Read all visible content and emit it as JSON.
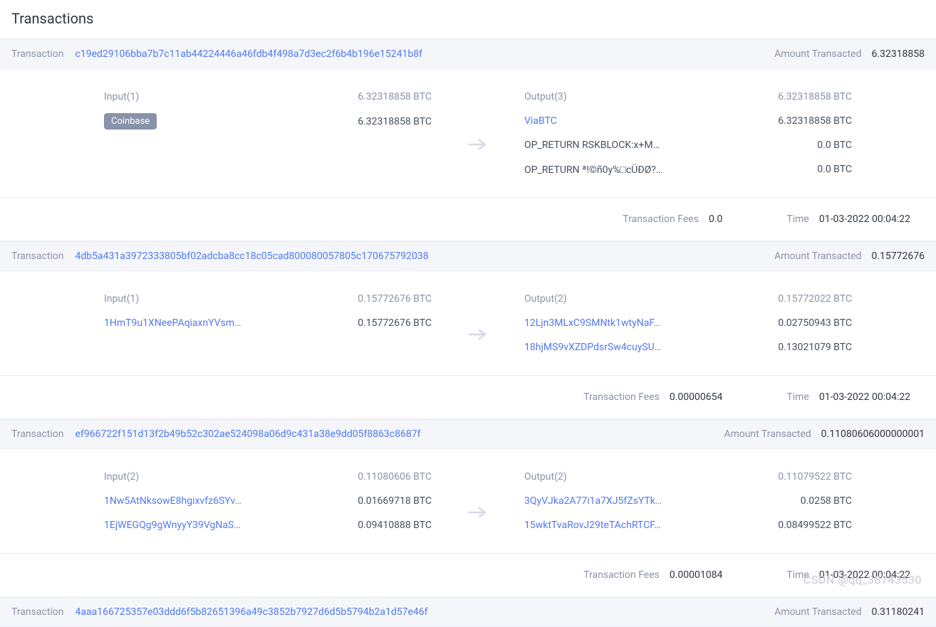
{
  "page_title": "Transactions",
  "labels": {
    "transaction": "Transaction",
    "amount_transacted": "Amount Transacted",
    "transaction_fees": "Transaction Fees",
    "time": "Time"
  },
  "watermark": "CSDN @qq_38743530",
  "transactions": [
    {
      "hash": "c19ed29106bba7b7c11ab44224446a46fdb4f498a7d3ec2f6b4b196e15241b8f",
      "amount_transacted": "6.32318858",
      "input": {
        "label": "Input(1)",
        "total": "6.32318858 BTC",
        "items": [
          {
            "tag": "Coinbase",
            "is_tag": true,
            "value": "6.32318858 BTC"
          }
        ]
      },
      "output": {
        "label": "Output(3)",
        "total": "6.32318858 BTC",
        "items": [
          {
            "text": "ViaBTC",
            "link": true,
            "value": "6.32318858 BTC"
          },
          {
            "text": "OP_RETURN RSKBLOCK:x+M…",
            "link": false,
            "value": "0.0 BTC"
          },
          {
            "text": "OP_RETURN ª!©ñ0y%□cÜÐØ?…",
            "link": false,
            "value": "0.0 BTC"
          }
        ]
      },
      "fees": "0.0",
      "time": "01-03-2022 00:04:22"
    },
    {
      "hash": "4db5a431a3972333805bf02adcba8cc18c05cad800080057805c170675792038",
      "amount_transacted": "0.15772676",
      "input": {
        "label": "Input(1)",
        "total": "0.15772676 BTC",
        "items": [
          {
            "text": "1HmT9u1XNeePAqiaxnYVsm…",
            "link": true,
            "value": "0.15772676 BTC"
          }
        ]
      },
      "output": {
        "label": "Output(2)",
        "total": "0.15772022 BTC",
        "items": [
          {
            "text": "12Ljn3MLxC9SMNtk1wtyNaF…",
            "link": true,
            "value": "0.02750943 BTC"
          },
          {
            "text": "18hjMS9vXZDPdsrSw4cuySU…",
            "link": true,
            "value": "0.13021079 BTC"
          }
        ]
      },
      "fees": "0.00000654",
      "time": "01-03-2022 00:04:22"
    },
    {
      "hash": "ef966722f151d13f2b49b52c302ae524098a06d9c431a38e9dd05f8863c8687f",
      "amount_transacted": "0.11080606000000001",
      "input": {
        "label": "Input(2)",
        "total": "0.11080606 BTC",
        "items": [
          {
            "text": "1Nw5AtNksowE8hgixvfz6SYv…",
            "link": true,
            "value": "0.01669718 BTC"
          },
          {
            "text": "1EjWEGQg9gWnyyY39VgNaS…",
            "link": true,
            "value": "0.09410888 BTC"
          }
        ]
      },
      "output": {
        "label": "Output(2)",
        "total": "0.11079522 BTC",
        "items": [
          {
            "text": "3QyVJka2A77i1a7XJ5fZsYTk…",
            "link": true,
            "value": "0.0258 BTC"
          },
          {
            "text": "15wktTvaRovJ29teTAchRTCF…",
            "link": true,
            "value": "0.08499522 BTC"
          }
        ]
      },
      "fees": "0.00001084",
      "time": "01-03-2022 00:04:22"
    },
    {
      "hash": "4aaa166725357e03ddd6f5b82651396a49c3852b7927d6d5b5794b2a1d57e46f",
      "amount_transacted": "0.31180241"
    }
  ]
}
